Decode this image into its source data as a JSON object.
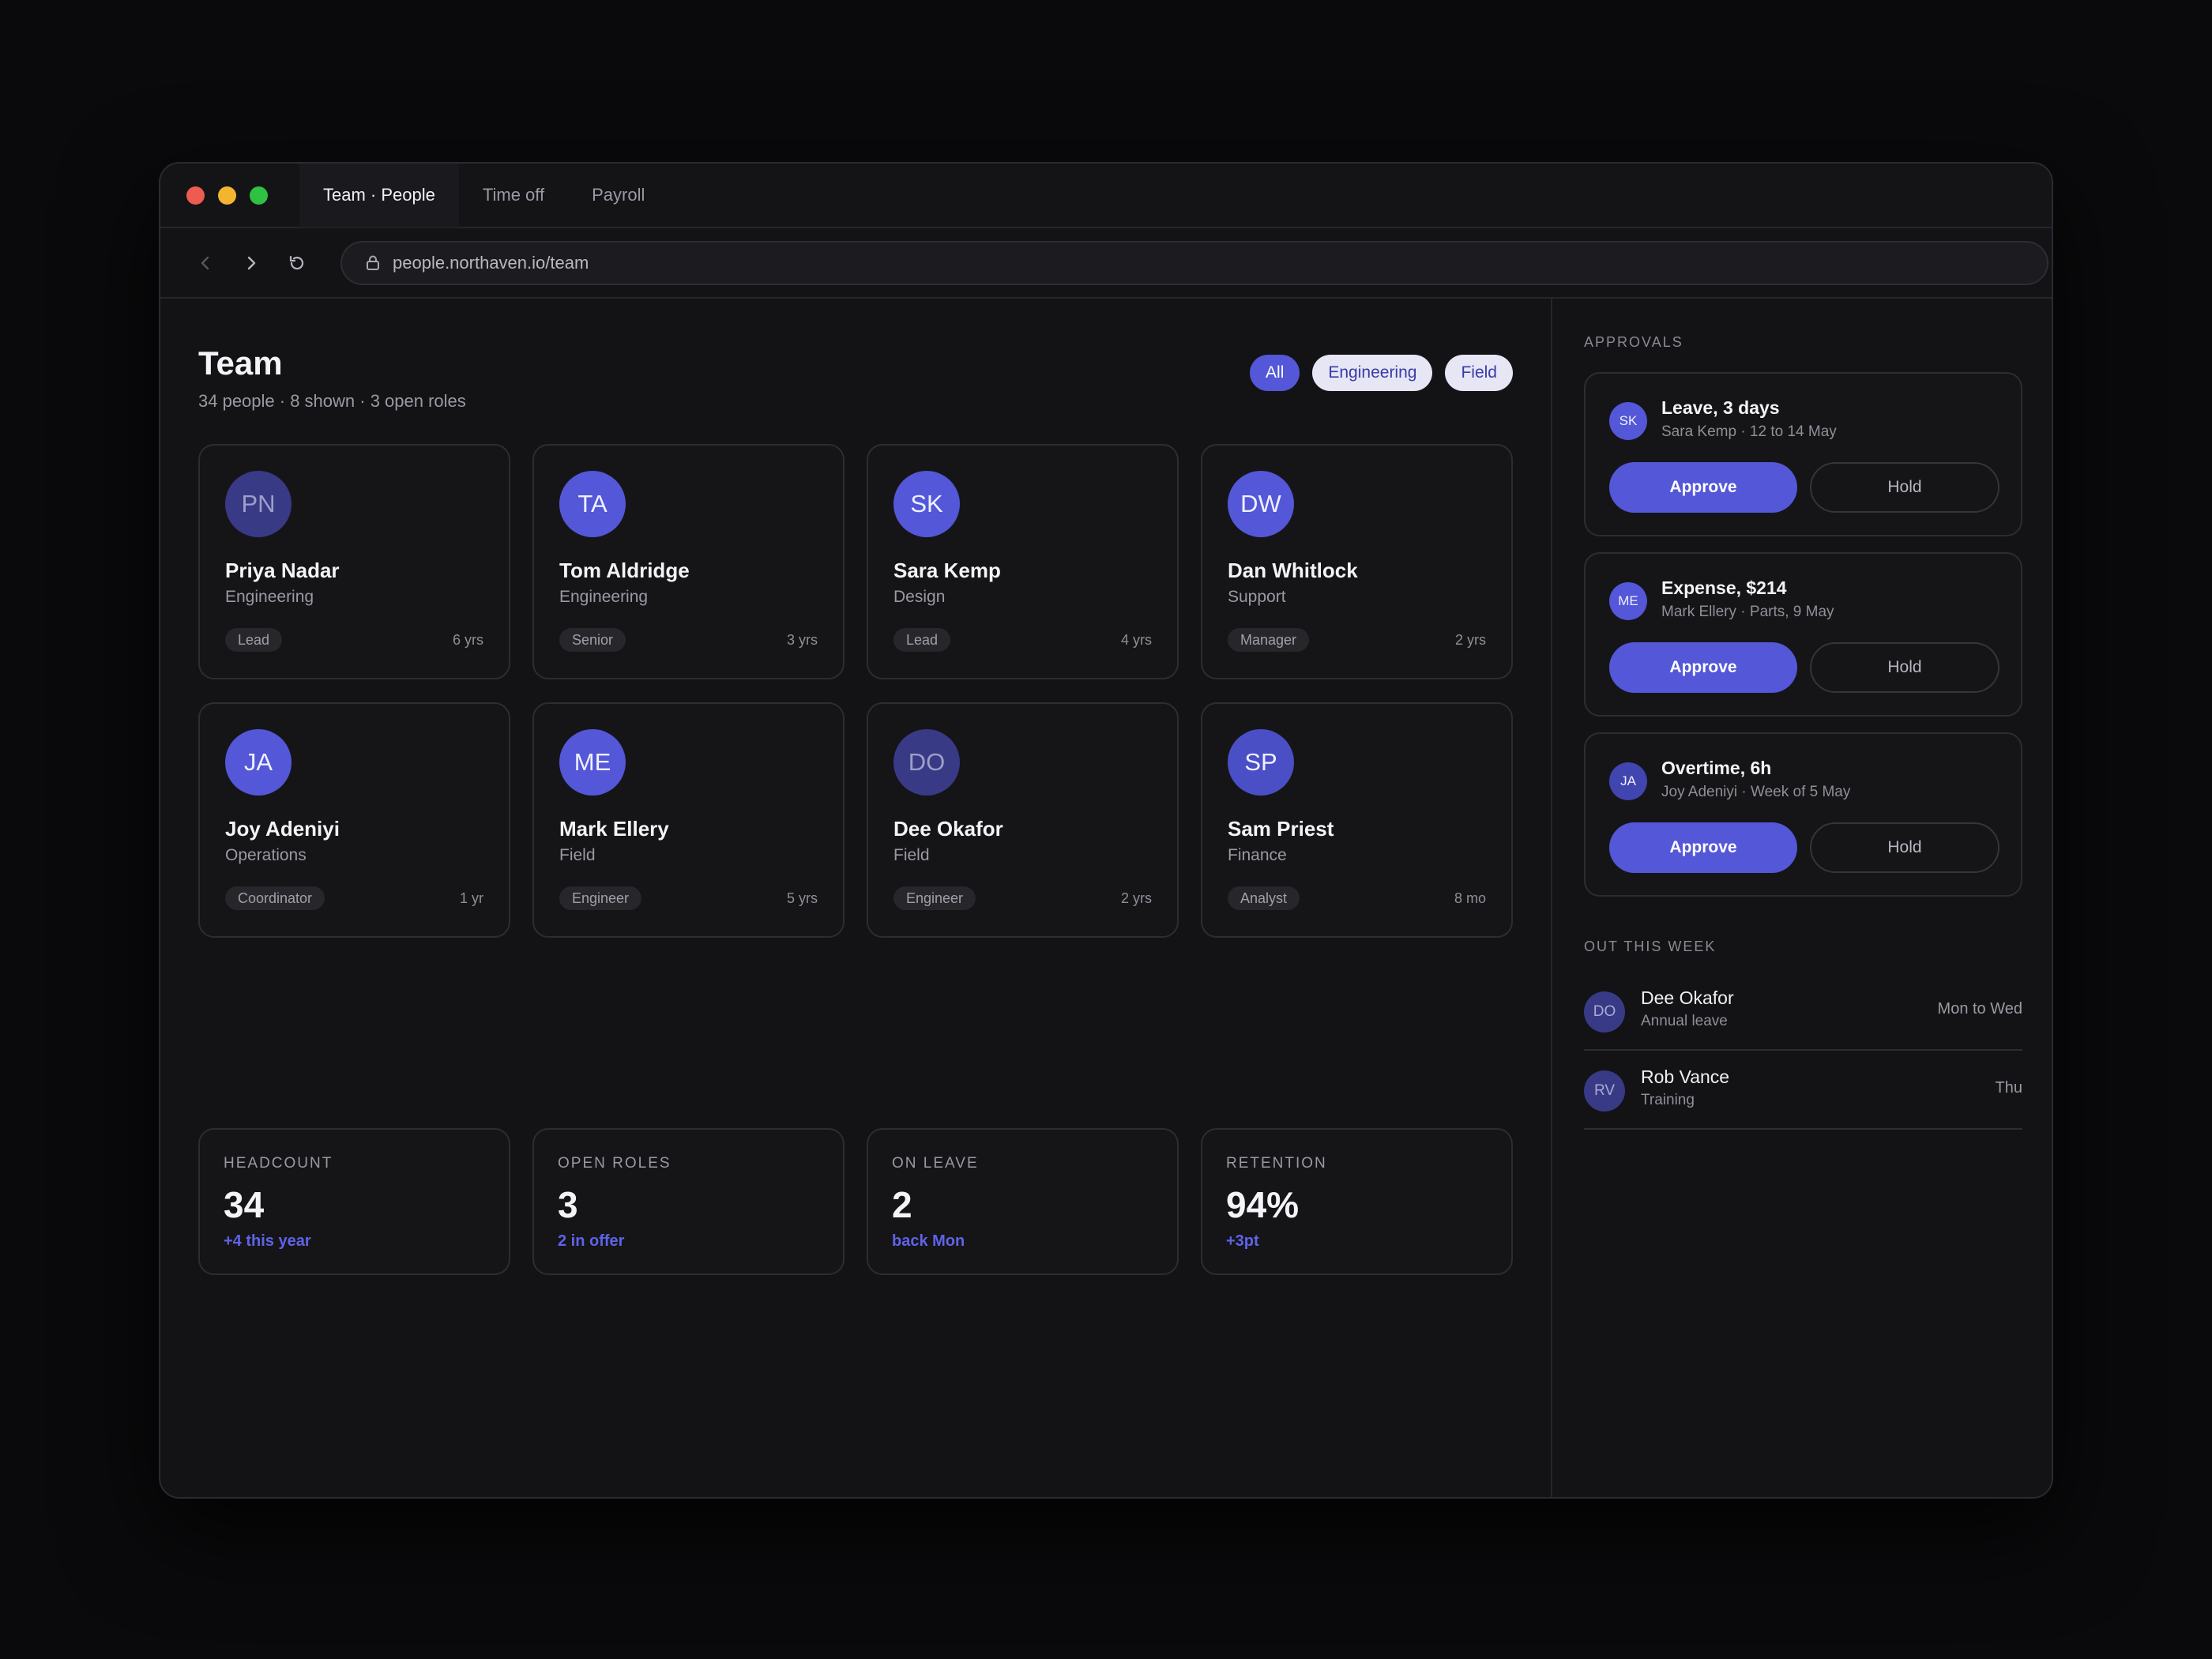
{
  "tabs": [
    {
      "label": "Team · People"
    },
    {
      "label": "Time off"
    },
    {
      "label": "Payroll"
    }
  ],
  "browser": {
    "url": "people.northaven.io/team"
  },
  "header": {
    "title": "Team",
    "subtitle": "34 people · 8 shown · 3 open roles"
  },
  "filters": [
    {
      "label": "All"
    },
    {
      "label": "Engineering"
    },
    {
      "label": "Field"
    }
  ],
  "people": [
    {
      "initials": "PN",
      "name": "Priya Nadar",
      "dept": "Engineering",
      "role": "Lead",
      "tenure": "6 yrs"
    },
    {
      "initials": "TA",
      "name": "Tom Aldridge",
      "dept": "Engineering",
      "role": "Senior",
      "tenure": "3 yrs"
    },
    {
      "initials": "SK",
      "name": "Sara Kemp",
      "dept": "Design",
      "role": "Lead",
      "tenure": "4 yrs"
    },
    {
      "initials": "DW",
      "name": "Dan Whitlock",
      "dept": "Support",
      "role": "Manager",
      "tenure": "2 yrs"
    },
    {
      "initials": "JA",
      "name": "Joy Adeniyi",
      "dept": "Operations",
      "role": "Coordinator",
      "tenure": "1 yr"
    },
    {
      "initials": "ME",
      "name": "Mark Ellery",
      "dept": "Field",
      "role": "Engineer",
      "tenure": "5 yrs"
    },
    {
      "initials": "DO",
      "name": "Dee Okafor",
      "dept": "Field",
      "role": "Engineer",
      "tenure": "2 yrs"
    },
    {
      "initials": "SP",
      "name": "Sam Priest",
      "dept": "Finance",
      "role": "Analyst",
      "tenure": "8 mo"
    }
  ],
  "stats": [
    {
      "label": "HEADCOUNT",
      "value": "34",
      "delta": "+4 this year"
    },
    {
      "label": "OPEN ROLES",
      "value": "3",
      "delta": "2 in offer"
    },
    {
      "label": "ON LEAVE",
      "value": "2",
      "delta": "back Mon"
    },
    {
      "label": "RETENTION",
      "value": "94%",
      "delta": "+3pt"
    }
  ],
  "approvals": {
    "label": "APPROVALS",
    "approve_label": "Approve",
    "hold_label": "Hold",
    "items": [
      {
        "initials": "SK",
        "title": "Leave, 3 days",
        "sub": "Sara Kemp · 12 to 14 May"
      },
      {
        "initials": "ME",
        "title": "Expense, $214",
        "sub": "Mark Ellery · Parts, 9 May"
      },
      {
        "initials": "JA",
        "title": "Overtime, 6h",
        "sub": "Joy Adeniyi · Week of 5 May"
      }
    ]
  },
  "out_this_week": {
    "label": "OUT THIS WEEK",
    "items": [
      {
        "initials": "DO",
        "name": "Dee Okafor",
        "reason": "Annual leave",
        "when": "Mon to Wed"
      },
      {
        "initials": "RV",
        "name": "Rob Vance",
        "reason": "Training",
        "when": "Thu"
      }
    ]
  },
  "colors": {
    "accent": "#5357d8",
    "background": "#131316",
    "card_border": "#2c2c32"
  }
}
